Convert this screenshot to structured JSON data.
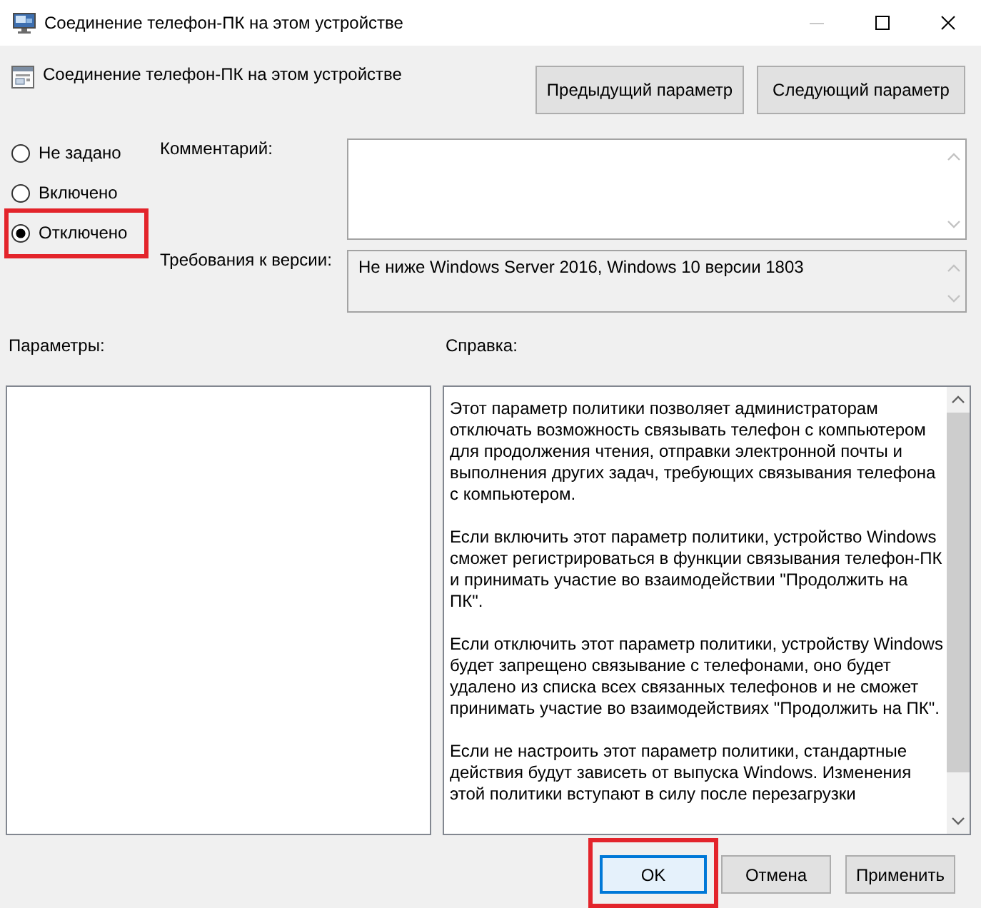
{
  "window": {
    "title": "Соединение телефон-ПК на этом устройстве",
    "controls": [
      {
        "kind": "minimize",
        "disabled": true
      },
      {
        "kind": "maximize",
        "disabled": false
      },
      {
        "kind": "close",
        "disabled": false
      }
    ]
  },
  "header": {
    "policy_name": "Соединение телефон-ПК на этом устройстве",
    "buttons": [
      {
        "label": "Предыдущий параметр"
      },
      {
        "label": "Следующий параметр"
      }
    ]
  },
  "state_options": [
    {
      "label": "Не задано",
      "selected": false,
      "highlighted": false
    },
    {
      "label": "Включено",
      "selected": false,
      "highlighted": false
    },
    {
      "label": "Отключено",
      "selected": true,
      "highlighted": true
    }
  ],
  "comment": {
    "label": "Комментарий:"
  },
  "version": {
    "label": "Требования к версии:",
    "value": "Не ниже Windows Server 2016, Windows 10 версии 1803"
  },
  "options_panel": {
    "label": "Параметры:"
  },
  "help_panel": {
    "label": "Справка:",
    "paragraphs": [
      "Этот параметр политики позволяет администраторам отключать возможность связывать телефон с компьютером для продолжения чтения, отправки электронной почты и выполнения других задач, требующих связывания телефона с компьютером.",
      "Если включить этот параметр политики, устройство Windows сможет регистрироваться в функции связывания телефон-ПК и принимать участие во взаимодействии \"Продолжить на ПК\".",
      "Если отключить этот параметр политики, устройству Windows будет запрещено связывание с телефонами, оно будет удалено из списка всех связанных телефонов и не сможет принимать участие во взаимодействиях \"Продолжить на ПК\".",
      "Если не настроить этот параметр политики, стандартные действия будут зависеть от выпуска Windows. Изменения этой политики вступают в силу после перезагрузки"
    ]
  },
  "footer_buttons": [
    {
      "label": "OK",
      "default": true,
      "highlighted": true
    },
    {
      "label": "Отмена",
      "default": false,
      "highlighted": false
    },
    {
      "label": "Применить",
      "default": false,
      "highlighted": false
    }
  ]
}
